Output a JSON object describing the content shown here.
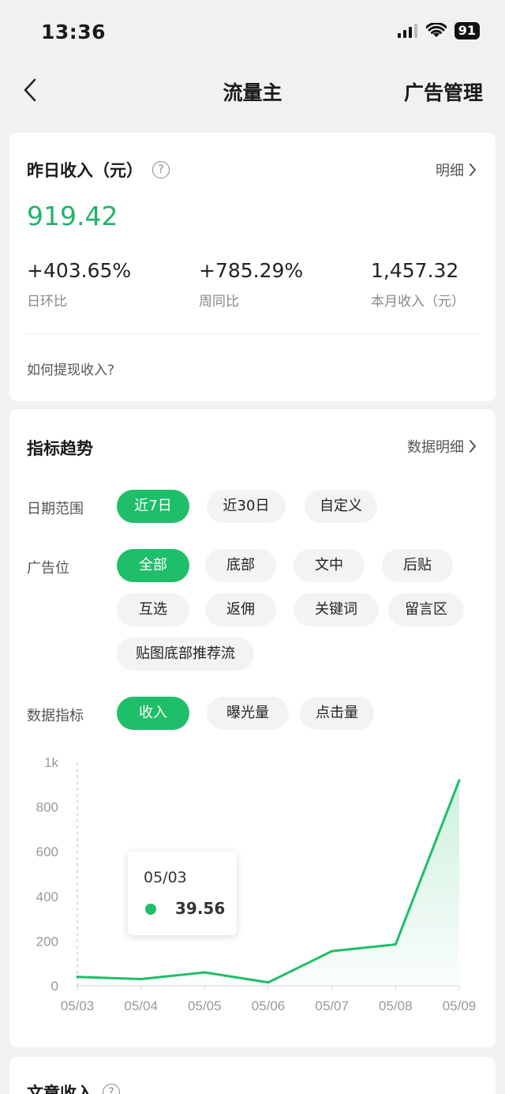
{
  "status": {
    "time": "13:36",
    "battery": "91"
  },
  "nav": {
    "title": "流量主",
    "action": "广告管理"
  },
  "income": {
    "title": "昨日收入（元）",
    "detail_link": "明细",
    "value": "919.42",
    "metrics": [
      {
        "value": "+403.65%",
        "label": "日环比"
      },
      {
        "value": "+785.29%",
        "label": "周同比"
      },
      {
        "value": "1,457.32",
        "label": "本月收入（元）"
      }
    ],
    "withdraw_link": "如何提现收入?"
  },
  "trend": {
    "title": "指标趋势",
    "detail_link": "数据明细",
    "date_range": {
      "label": "日期范围",
      "options": [
        "近7日",
        "近30日",
        "自定义"
      ],
      "selected": "近7日"
    },
    "ad_position": {
      "label": "广告位",
      "options": [
        "全部",
        "底部",
        "文中",
        "后贴",
        "互选",
        "返佣",
        "关键词",
        "留言区",
        "贴图底部推荐流"
      ],
      "selected": "全部"
    },
    "metric": {
      "label": "数据指标",
      "options": [
        "收入",
        "曝光量",
        "点击量"
      ],
      "selected": "收入"
    },
    "tooltip": {
      "date": "05/03",
      "value": "39.56"
    }
  },
  "article": {
    "title": "文章收入"
  },
  "colors": {
    "accent": "#1fbe6a",
    "value_green": "#22b26a"
  },
  "chart_data": {
    "type": "line",
    "categories": [
      "05/03",
      "05/04",
      "05/05",
      "05/06",
      "05/07",
      "05/08",
      "05/09"
    ],
    "series": [
      {
        "values": [
          39.56,
          30,
          60,
          15,
          155,
          185,
          919.42
        ]
      }
    ],
    "ylim": [
      0,
      1000
    ],
    "yticks": [
      "0",
      "200",
      "400",
      "600",
      "800",
      "1k"
    ],
    "ytick_values": [
      0,
      200,
      400,
      600,
      800,
      1000
    ],
    "grid": false,
    "area_fill": true,
    "highlighted_category": "05/03"
  }
}
